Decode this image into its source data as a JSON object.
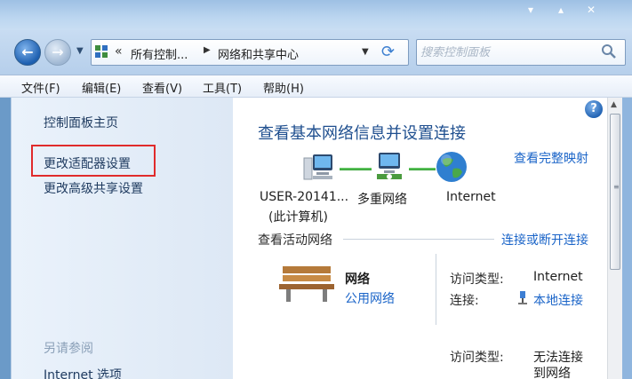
{
  "window": {
    "controls": {
      "minimize": "▾",
      "maximize": "▴",
      "close": "✕"
    }
  },
  "nav": {
    "back_icon": "arrow-left-icon",
    "forward_icon": "arrow-right-icon",
    "breadcrumb_chevrons": "«",
    "breadcrumb": [
      "所有控制...",
      "网络和共享中心"
    ],
    "search_placeholder": "搜索控制面板"
  },
  "menu": [
    "文件(F)",
    "编辑(E)",
    "查看(V)",
    "工具(T)",
    "帮助(H)"
  ],
  "sidebar": {
    "links": [
      "控制面板主页",
      "更改适配器设置",
      "更改高级共享设置"
    ],
    "highlighted_index": 1,
    "see_also_heading": "另请参阅",
    "see_also_links": [
      "Internet 选项"
    ]
  },
  "main": {
    "help_label": "?",
    "title": "查看基本网络信息并设置连接",
    "full_map_link": "查看完整映射",
    "nodes": [
      {
        "label_line1": "USER-20141...",
        "label_line2": "(此计算机)",
        "icon": "computer-icon"
      },
      {
        "label_line1": "多重网络",
        "icon": "network-icon"
      },
      {
        "label_line1": "Internet",
        "icon": "globe-icon"
      }
    ],
    "active_networks_label": "查看活动网络",
    "connect_link": "连接或断开连接",
    "network": {
      "name": "网络",
      "type": "公用网络",
      "access_type_label": "访问类型:",
      "access_type_value": "Internet",
      "connection_label": "连接:",
      "connection_value": "本地连接"
    },
    "network2": {
      "access_type_label": "访问类型:",
      "access_type_value_line1": "无法连接",
      "access_type_value_line2": "到网络"
    }
  },
  "colors": {
    "accent_blue": "#1a64c8",
    "title_blue": "#1f4f8f",
    "highlight_red": "#e02b2b"
  }
}
